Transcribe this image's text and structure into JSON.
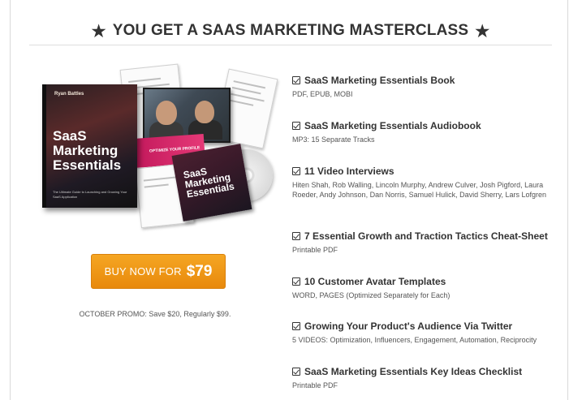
{
  "header": {
    "title": "YOU GET A SAAS MARKETING MASTERCLASS",
    "left_icon": "star-icon",
    "right_icon": "star-icon"
  },
  "product_image": {
    "book_author": "Ryan Battles",
    "book_title": "SaaS Marketing Essentials",
    "book_subtitle": "The Ultimate Guide to Launching and Growing Your SaaS Application",
    "card_text": "OPTIMIZE YOUR PROFILE",
    "case_title": "SaaS Marketing Essentials"
  },
  "buy_button": {
    "label": "BUY NOW FOR",
    "price": "$79",
    "color": "#f0961a"
  },
  "promo": "OCTOBER PROMO: Save $20, Regularly $99.",
  "features": [
    {
      "title": "SaaS Marketing Essentials Book",
      "detail": "PDF, EPUB, MOBI",
      "icon": "checkbox-checked-icon"
    },
    {
      "title": "SaaS Marketing Essentials Audiobook",
      "detail": "MP3: 15 Separate Tracks",
      "icon": "checkbox-checked-icon"
    },
    {
      "title": "11 Video Interviews",
      "detail": "Hiten Shah, Rob Walling, Lincoln Murphy, Andrew Culver, Josh Pigford, Laura Roeder, Andy Johnson, Dan Norris, Samuel Hulick, David Sherry, Lars Lofgren",
      "icon": "checkbox-checked-icon"
    },
    {
      "title": "7 Essential Growth and Traction Tactics Cheat-Sheet",
      "detail": "Printable PDF",
      "icon": "checkbox-checked-icon"
    },
    {
      "title": "10 Customer Avatar Templates",
      "detail": "WORD, PAGES (Optimized Separately for Each)",
      "icon": "checkbox-checked-icon"
    },
    {
      "title": "Growing Your Product's Audience Via Twitter",
      "detail": "5 VIDEOS: Optimization, Influencers, Engagement, Automation, Reciprocity",
      "icon": "checkbox-checked-icon"
    },
    {
      "title": "SaaS Marketing Essentials Key Ideas Checklist",
      "detail": "Printable PDF",
      "icon": "checkbox-checked-icon"
    }
  ]
}
